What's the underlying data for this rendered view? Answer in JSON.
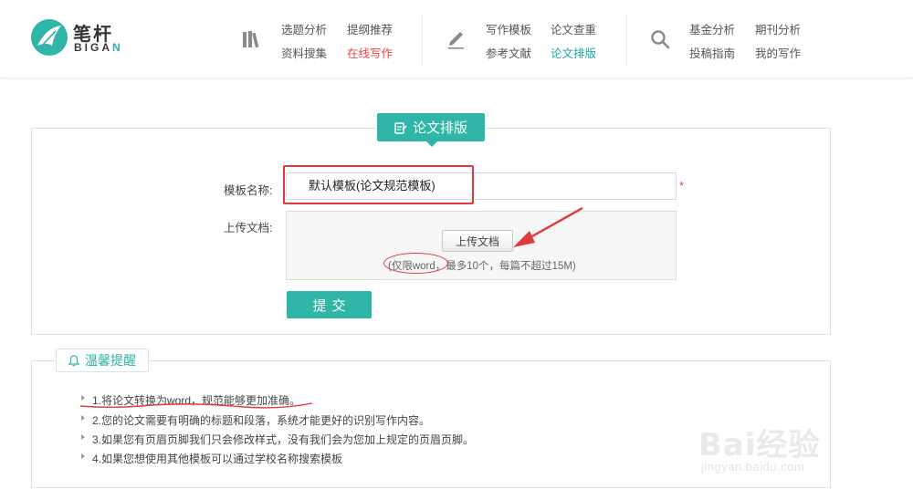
{
  "brand": {
    "name_cn": "笔杆",
    "name_en_main": "BIGA",
    "name_en_accent": "N"
  },
  "nav": {
    "group1": {
      "icon": "books-icon",
      "links": [
        "选题分析",
        "提纲推荐",
        "资料搜集",
        "在线写作"
      ]
    },
    "group2": {
      "icon": "pencil-icon",
      "links": [
        "写作模板",
        "论文查重",
        "参考文献",
        "论文排版"
      ]
    },
    "group3": {
      "icon": "search-icon",
      "links": [
        "基金分析",
        "期刊分析",
        "投稿指南",
        "我的写作"
      ]
    }
  },
  "form": {
    "title": "论文排版",
    "template_label": "模板名称:",
    "template_value": "默认模板(论文规范模板)",
    "required_mark": "*",
    "upload_label": "上传文档:",
    "upload_button": "上传文档",
    "upload_hint": "(仅限word，最多10个，每篇不超过15M)",
    "submit_button": "提交"
  },
  "tips": {
    "title": "温馨提醒",
    "items": [
      "1.将论文转换为word，规范能够更加准确。",
      "2.您的论文需要有明确的标题和段落，系统才能更好的识别写作内容。",
      "3.如果您有页眉页脚我们只会修改样式，没有我们会为您加上规定的页眉页脚。",
      "4.如果您想使用其他模板可以通过学校名称搜索模板"
    ]
  },
  "watermark": {
    "main": "Bai经验",
    "sub": "jingyan.baidu.com"
  },
  "colors": {
    "accent": "#2fb6a9",
    "annotation": "#e0393e",
    "active_link": "#e64545"
  }
}
